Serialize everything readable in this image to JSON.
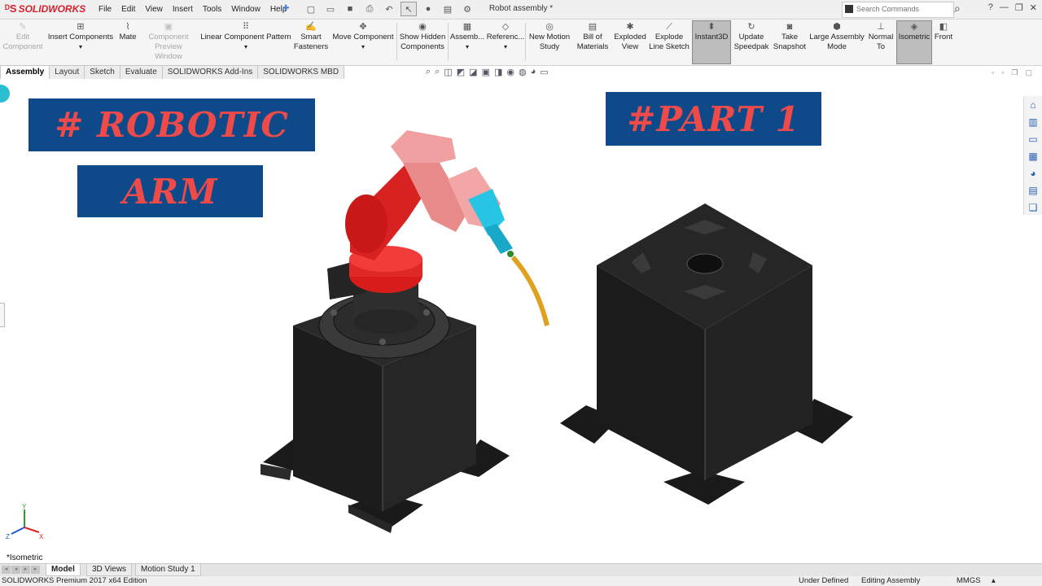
{
  "titlebar": {
    "app_name": "SOLIDWORKS",
    "menu": [
      "File",
      "Edit",
      "View",
      "Insert",
      "Tools",
      "Window",
      "Help"
    ],
    "document_title": "Robot assembly *",
    "search_placeholder": "Search Commands",
    "help_label": "?"
  },
  "ribbon": {
    "edit_component": "Edit Component",
    "insert_components": "Insert Components",
    "mate": "Mate",
    "component_preview": "Component Preview Window",
    "linear_pattern": "Linear Component Pattern",
    "smart_fasteners": "Smart Fasteners",
    "move_component": "Move Component",
    "show_hidden": "Show Hidden Components",
    "assembly_features": "Assemb...",
    "reference_geometry": "Referenc...",
    "new_motion_study": "New Motion Study",
    "bill_of_materials": "Bill of Materials",
    "exploded_view": "Exploded View",
    "explode_line_sketch": "Explode Line Sketch",
    "instant3d": "Instant3D",
    "update_speedpak": "Update Speedpak",
    "take_snapshot": "Take Snapshot",
    "large_assembly_mode": "Large Assembly Mode",
    "normal_to": "Normal To",
    "isometric": "Isometric",
    "front": "Front"
  },
  "command_tabs": [
    "Assembly",
    "Layout",
    "Sketch",
    "Evaluate",
    "SOLIDWORKS Add-Ins",
    "SOLIDWORKS MBD"
  ],
  "graphics": {
    "banner_robotic": "# ROBOTIC",
    "banner_arm": "ARM",
    "banner_part": "#PART 1",
    "view_orientation": "*Isometric",
    "triad": {
      "x": "X",
      "y": "Y",
      "z": "Z"
    }
  },
  "bottom_tabs": [
    "Model",
    "3D Views",
    "Motion Study 1"
  ],
  "status": {
    "edition": "SOLIDWORKS Premium 2017 x64 Edition",
    "definition": "Under Defined",
    "mode": "Editing Assembly",
    "units": "MMGS"
  },
  "colors": {
    "banner_bg": "#0e4a8a",
    "banner_text": "#ef4a4a",
    "arm_red": "#e02828",
    "arm_pink": "#f0a0a0",
    "tool_cyan": "#27c4e4",
    "wire_gold": "#e0a020",
    "base_black": "#1e1e1e"
  }
}
